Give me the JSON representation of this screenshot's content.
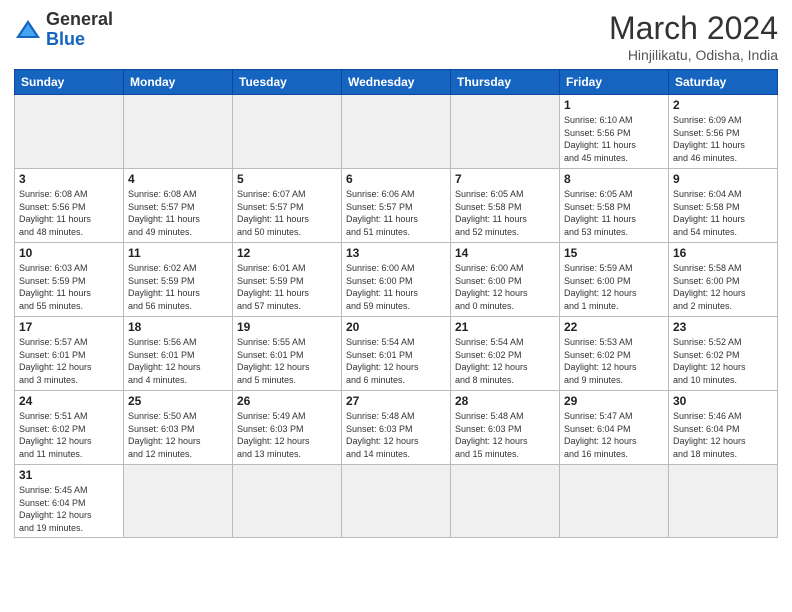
{
  "header": {
    "logo_general": "General",
    "logo_blue": "Blue",
    "month_title": "March 2024",
    "location": "Hinjilikatu, Odisha, India"
  },
  "days_of_week": [
    "Sunday",
    "Monday",
    "Tuesday",
    "Wednesday",
    "Thursday",
    "Friday",
    "Saturday"
  ],
  "weeks": [
    [
      {
        "day": "",
        "info": ""
      },
      {
        "day": "",
        "info": ""
      },
      {
        "day": "",
        "info": ""
      },
      {
        "day": "",
        "info": ""
      },
      {
        "day": "",
        "info": ""
      },
      {
        "day": "1",
        "info": "Sunrise: 6:10 AM\nSunset: 5:56 PM\nDaylight: 11 hours\nand 45 minutes."
      },
      {
        "day": "2",
        "info": "Sunrise: 6:09 AM\nSunset: 5:56 PM\nDaylight: 11 hours\nand 46 minutes."
      }
    ],
    [
      {
        "day": "3",
        "info": "Sunrise: 6:08 AM\nSunset: 5:56 PM\nDaylight: 11 hours\nand 48 minutes."
      },
      {
        "day": "4",
        "info": "Sunrise: 6:08 AM\nSunset: 5:57 PM\nDaylight: 11 hours\nand 49 minutes."
      },
      {
        "day": "5",
        "info": "Sunrise: 6:07 AM\nSunset: 5:57 PM\nDaylight: 11 hours\nand 50 minutes."
      },
      {
        "day": "6",
        "info": "Sunrise: 6:06 AM\nSunset: 5:57 PM\nDaylight: 11 hours\nand 51 minutes."
      },
      {
        "day": "7",
        "info": "Sunrise: 6:05 AM\nSunset: 5:58 PM\nDaylight: 11 hours\nand 52 minutes."
      },
      {
        "day": "8",
        "info": "Sunrise: 6:05 AM\nSunset: 5:58 PM\nDaylight: 11 hours\nand 53 minutes."
      },
      {
        "day": "9",
        "info": "Sunrise: 6:04 AM\nSunset: 5:58 PM\nDaylight: 11 hours\nand 54 minutes."
      }
    ],
    [
      {
        "day": "10",
        "info": "Sunrise: 6:03 AM\nSunset: 5:59 PM\nDaylight: 11 hours\nand 55 minutes."
      },
      {
        "day": "11",
        "info": "Sunrise: 6:02 AM\nSunset: 5:59 PM\nDaylight: 11 hours\nand 56 minutes."
      },
      {
        "day": "12",
        "info": "Sunrise: 6:01 AM\nSunset: 5:59 PM\nDaylight: 11 hours\nand 57 minutes."
      },
      {
        "day": "13",
        "info": "Sunrise: 6:00 AM\nSunset: 6:00 PM\nDaylight: 11 hours\nand 59 minutes."
      },
      {
        "day": "14",
        "info": "Sunrise: 6:00 AM\nSunset: 6:00 PM\nDaylight: 12 hours\nand 0 minutes."
      },
      {
        "day": "15",
        "info": "Sunrise: 5:59 AM\nSunset: 6:00 PM\nDaylight: 12 hours\nand 1 minute."
      },
      {
        "day": "16",
        "info": "Sunrise: 5:58 AM\nSunset: 6:00 PM\nDaylight: 12 hours\nand 2 minutes."
      }
    ],
    [
      {
        "day": "17",
        "info": "Sunrise: 5:57 AM\nSunset: 6:01 PM\nDaylight: 12 hours\nand 3 minutes."
      },
      {
        "day": "18",
        "info": "Sunrise: 5:56 AM\nSunset: 6:01 PM\nDaylight: 12 hours\nand 4 minutes."
      },
      {
        "day": "19",
        "info": "Sunrise: 5:55 AM\nSunset: 6:01 PM\nDaylight: 12 hours\nand 5 minutes."
      },
      {
        "day": "20",
        "info": "Sunrise: 5:54 AM\nSunset: 6:01 PM\nDaylight: 12 hours\nand 6 minutes."
      },
      {
        "day": "21",
        "info": "Sunrise: 5:54 AM\nSunset: 6:02 PM\nDaylight: 12 hours\nand 8 minutes."
      },
      {
        "day": "22",
        "info": "Sunrise: 5:53 AM\nSunset: 6:02 PM\nDaylight: 12 hours\nand 9 minutes."
      },
      {
        "day": "23",
        "info": "Sunrise: 5:52 AM\nSunset: 6:02 PM\nDaylight: 12 hours\nand 10 minutes."
      }
    ],
    [
      {
        "day": "24",
        "info": "Sunrise: 5:51 AM\nSunset: 6:02 PM\nDaylight: 12 hours\nand 11 minutes."
      },
      {
        "day": "25",
        "info": "Sunrise: 5:50 AM\nSunset: 6:03 PM\nDaylight: 12 hours\nand 12 minutes."
      },
      {
        "day": "26",
        "info": "Sunrise: 5:49 AM\nSunset: 6:03 PM\nDaylight: 12 hours\nand 13 minutes."
      },
      {
        "day": "27",
        "info": "Sunrise: 5:48 AM\nSunset: 6:03 PM\nDaylight: 12 hours\nand 14 minutes."
      },
      {
        "day": "28",
        "info": "Sunrise: 5:48 AM\nSunset: 6:03 PM\nDaylight: 12 hours\nand 15 minutes."
      },
      {
        "day": "29",
        "info": "Sunrise: 5:47 AM\nSunset: 6:04 PM\nDaylight: 12 hours\nand 16 minutes."
      },
      {
        "day": "30",
        "info": "Sunrise: 5:46 AM\nSunset: 6:04 PM\nDaylight: 12 hours\nand 18 minutes."
      }
    ],
    [
      {
        "day": "31",
        "info": "Sunrise: 5:45 AM\nSunset: 6:04 PM\nDaylight: 12 hours\nand 19 minutes."
      },
      {
        "day": "",
        "info": ""
      },
      {
        "day": "",
        "info": ""
      },
      {
        "day": "",
        "info": ""
      },
      {
        "day": "",
        "info": ""
      },
      {
        "day": "",
        "info": ""
      },
      {
        "day": "",
        "info": ""
      }
    ]
  ]
}
